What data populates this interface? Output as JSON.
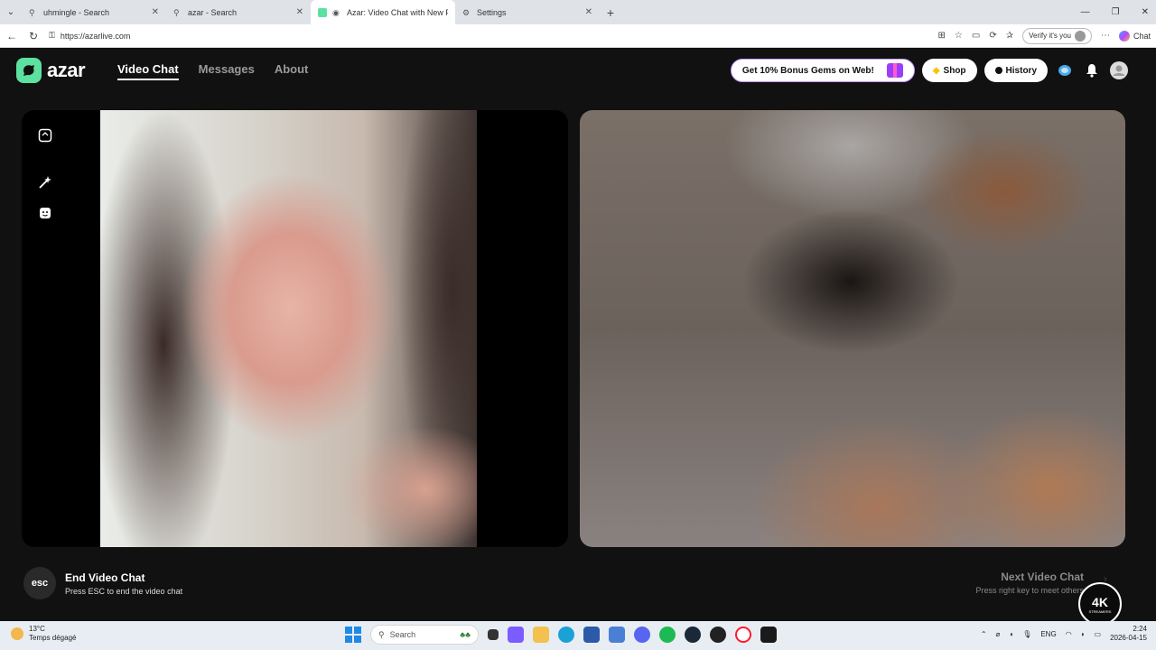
{
  "browser": {
    "tabs": [
      {
        "title": "uhmingle - Search",
        "icon": "search-icon"
      },
      {
        "title": "azar - Search",
        "icon": "search-icon"
      },
      {
        "title": "Azar: Video Chat with New Pe",
        "icon": "azar-icon",
        "active": true
      },
      {
        "title": "Settings",
        "icon": "gear-icon"
      }
    ],
    "url": "https://azarlive.com",
    "verify_label": "Verify it's you",
    "copilot_label": "Chat"
  },
  "site": {
    "logo_text": "azar",
    "nav": [
      {
        "label": "Video Chat",
        "active": true
      },
      {
        "label": "Messages"
      },
      {
        "label": "About"
      }
    ],
    "bonus_label": "Get 10% Bonus Gems on Web!",
    "shop_label": "Shop",
    "history_label": "History",
    "colors": {
      "accent": "#5ce1a0",
      "background": "#111111",
      "bonus_border": "#c09bff"
    }
  },
  "controls": {
    "esc_label": "esc",
    "end_title": "End Video Chat",
    "end_sub": "Press ESC to end the video chat",
    "next_title": "Next Video Chat",
    "next_sub": "Press right key to meet others"
  },
  "watermark": {
    "text": "4K",
    "sub": "STREAMERS"
  },
  "taskbar": {
    "temp": "13°C",
    "weather": "Temps dégagé",
    "search_placeholder": "Search",
    "lang": "ENG",
    "time": "2:24",
    "date": "2026-04-15"
  }
}
